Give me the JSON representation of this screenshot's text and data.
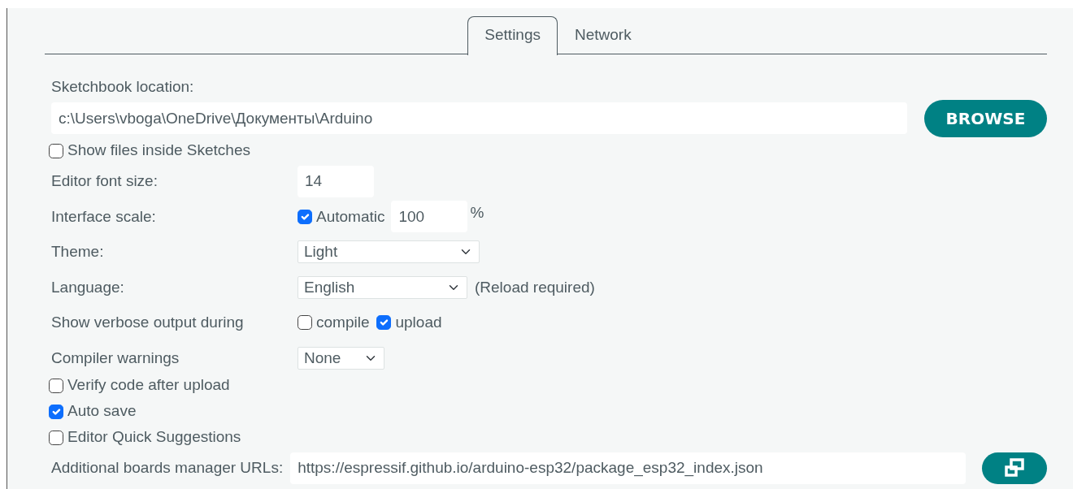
{
  "tabs": [
    {
      "label": "Settings",
      "selected": true
    },
    {
      "label": "Network",
      "selected": false
    }
  ],
  "sketchbook_location": {
    "label": "Sketchbook location:",
    "value": "c:\\Users\\vboga\\OneDrive\\Документы\\Arduino",
    "button": "BROWSE"
  },
  "show_files_inside_sketches": {
    "label": "Show files inside Sketches",
    "checked": false
  },
  "rows": [
    {
      "kind": "input",
      "label": "Editor font size:",
      "value": "14"
    },
    {
      "kind": "scale",
      "label": "Interface scale:",
      "checkbox": {
        "label": "Automatic",
        "checked": true
      },
      "value": "100",
      "unit": "%"
    },
    {
      "kind": "select",
      "label": "Theme:",
      "value": "Light"
    },
    {
      "kind": "select",
      "label": "Language:",
      "value": "English",
      "note": "(Reload required)"
    },
    {
      "kind": "checks",
      "label": "Show verbose output during",
      "options": [
        {
          "label": "compile",
          "checked": false
        },
        {
          "label": "upload",
          "checked": true
        }
      ]
    },
    {
      "kind": "select",
      "label": "Compiler warnings",
      "value": "None"
    }
  ],
  "options": [
    {
      "label": "Verify code after upload",
      "checked": false
    },
    {
      "label": "Auto save",
      "checked": true
    },
    {
      "label": "Editor Quick Suggestions",
      "checked": false
    }
  ],
  "additional_urls": {
    "label": "Additional boards manager URLs:",
    "value": "https://espressif.github.io/arduino-esp32/package_esp32_index.json"
  }
}
